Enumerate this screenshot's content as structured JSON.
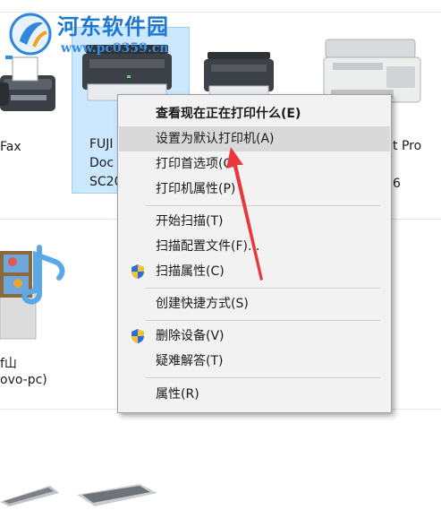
{
  "watermark": {
    "title": "河东软件园",
    "url": "www.pc0359.cn"
  },
  "devices": {
    "fax": {
      "label": "Fax"
    },
    "fuji": {
      "line1": "FUJI",
      "line2": "Doc",
      "line3": "SC20"
    },
    "third_printer": {
      "line1": "t Pro",
      "line2": "6"
    },
    "media_device": {
      "line1": "f山",
      "line2": "ovo-pc)"
    }
  },
  "context_menu": {
    "items": [
      {
        "label": "查看现在正在打印什么(E)",
        "bold": true
      },
      {
        "label": "设置为默认打印机(A)",
        "highlighted": true
      },
      {
        "label": "打印首选项(O)"
      },
      {
        "label": "打印机属性(P)"
      },
      {
        "label": "开始扫描(T)"
      },
      {
        "label": "扫描配置文件(F)..."
      },
      {
        "label": "扫描属性(C)",
        "icon": "uac-shield-icon"
      },
      {
        "label": "创建快捷方式(S)"
      },
      {
        "label": "删除设备(V)",
        "icon": "uac-shield-icon"
      },
      {
        "label": "疑难解答(T)"
      },
      {
        "label": "属性(R)"
      }
    ]
  },
  "colors": {
    "selection_bg": "#cce8ff",
    "selection_border": "#99d1ff",
    "menu_bg": "#f2f2f2",
    "menu_hover": "#d9d9d9",
    "annotation_arrow": "#e8383d"
  }
}
